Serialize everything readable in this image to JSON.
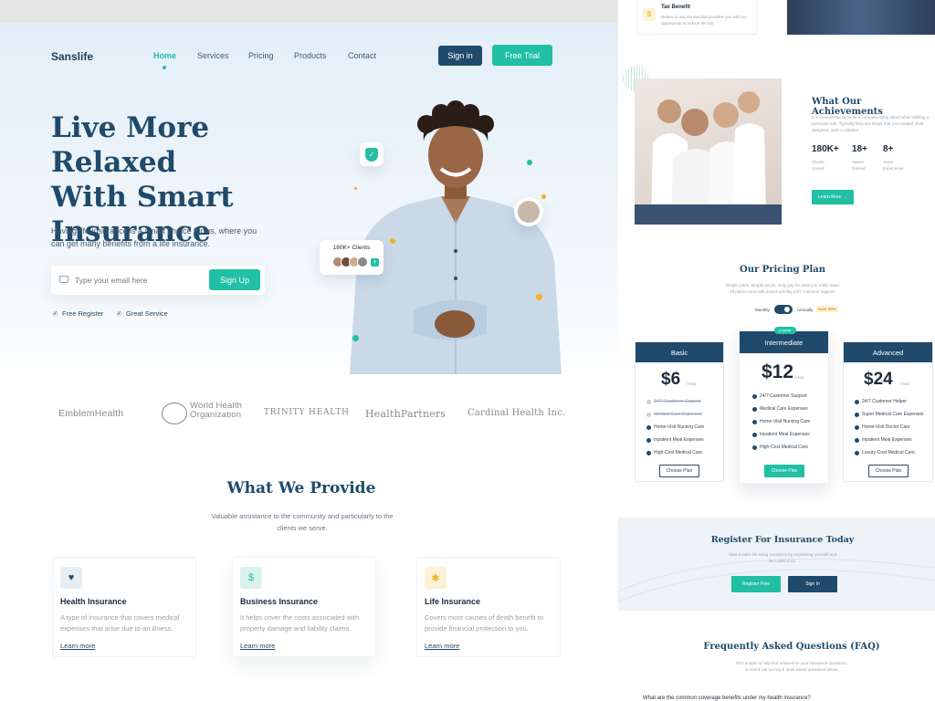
{
  "main": {
    "brand": "Sanslife",
    "nav": [
      "Home",
      "Services",
      "Pricing",
      "Products",
      "Contact"
    ],
    "signin": "Sign in",
    "trial": "Free Trial",
    "hero_title_1": "Live More Relaxed",
    "hero_title_2": "With Smart",
    "hero_title_3": "Insurance",
    "hero_sub": "Having life insurance is a smart choice for us, where you can get many benefits from a life insurance.",
    "email_placeholder": "Type your email here",
    "signup": "Sign Up",
    "check1": "Free Register",
    "check2": "Great Service",
    "clients_badge": "180K+ Clients",
    "partners": [
      "EmblemHealth",
      "World Health Organization",
      "TRINITY HEALTH",
      "HealthPartners",
      "Cardinal Health Inc."
    ],
    "provide_title": "What We Provide",
    "provide_sub": "Valuable assistance to the community and particularly to the clients we serve.",
    "cards": [
      {
        "title": "Health Insurance",
        "desc": "A type of insurance that covers medical expenses that arise due to an illness.",
        "link": "Learn more"
      },
      {
        "title": "Business Insurance",
        "desc": "It helps cover the costs associated with property damage and liability claims.",
        "link": "Learn more"
      },
      {
        "title": "Life Insurance",
        "desc": "Covers most causes of death benefit to provide financial protection to you.",
        "link": "Learn more"
      }
    ]
  },
  "side": {
    "tax_title": "Tax Benefit",
    "tax_desc": "Refers to any tax law that provides you with an opportunity to reduce the tax.",
    "ach_title": "What Our Achievements",
    "ach_desc": "It is a result that we're as a company bring about while fulfilling a particular role. Typically they are things that you created, built, designed, sold or initiated.",
    "stats": [
      {
        "num": "180K+",
        "l1": "Clients",
        "l2": "Joined"
      },
      {
        "num": "18+",
        "l1": "Award",
        "l2": "Gained"
      },
      {
        "num": "8+",
        "l1": "Years",
        "l2": "Experience"
      }
    ],
    "learn_more": "Learn More",
    "pricing_title": "Our Pricing Plan",
    "pricing_sub1": "Simple plans. Simple prices. Only pay for what you really need.",
    "pricing_sub2": "All plans come with award-winning 24/7 customer support.",
    "monthly": "Monthly",
    "annually": "Annually",
    "save": "save 20%",
    "popular": "popular",
    "per": "/Year",
    "plans": [
      {
        "name": "Basic",
        "price": "$6",
        "features": [
          "24/7 Customer Support",
          "Medical Care Expenses",
          "Home-Visit Nursing Care",
          "Inpatient Meal Expenses",
          "High-Cost Medical Care"
        ],
        "btn": "Choose Plan"
      },
      {
        "name": "Intermediate",
        "price": "$12",
        "features": [
          "24/7 Customer Support",
          "Medical Care Expenses",
          "Home-Visit Nursing Care",
          "Inpatient Meal Expenses",
          "High-Cost Medical Care"
        ],
        "btn": "Choose Plan"
      },
      {
        "name": "Advanced",
        "price": "$24",
        "features": [
          "24/7 Customer Helper",
          "Super Medical Care Expenses",
          "Home-Visit Doctor Care",
          "Inpatient Meal Expenses",
          "Luxury-Cost Medical Care"
        ],
        "btn": "Choose Plan"
      }
    ],
    "reg_title": "Register For Insurance Today",
    "reg_sub1": "Start a safer life using insurance by registering yourself and",
    "reg_sub2": "be a part of us.",
    "reg_free": "Register Free",
    "reg_signin": "Sign In",
    "faq_title": "Frequently Asked Questions (FAQ)",
    "faq_sub1": "Pick a topic to help find answers to your insurance questions,",
    "faq_sub2": "or check out our top 5 most asked questions below.",
    "faq_q": "What are the common coverage benefits under my health insurance?"
  },
  "colors": {
    "navy": "#1f4a6b",
    "teal": "#21bfa4",
    "gold": "#f2b21c"
  }
}
